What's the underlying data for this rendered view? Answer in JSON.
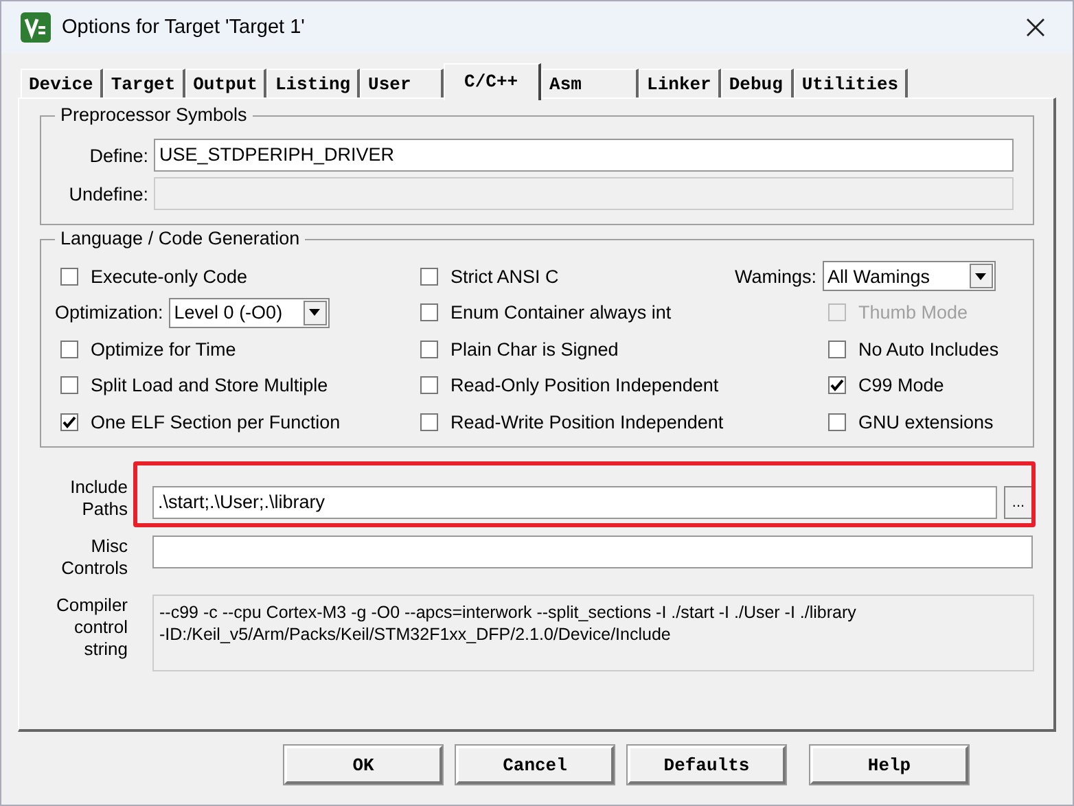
{
  "window": {
    "title": "Options for Target 'Target 1'"
  },
  "tabs": [
    {
      "label": "Device",
      "selected": false
    },
    {
      "label": "Target",
      "selected": false
    },
    {
      "label": "Output",
      "selected": false
    },
    {
      "label": "Listing",
      "selected": false
    },
    {
      "label": "User",
      "selected": false
    },
    {
      "label": "C/C++",
      "selected": true
    },
    {
      "label": "Asm",
      "selected": false
    },
    {
      "label": "Linker",
      "selected": false
    },
    {
      "label": "Debug",
      "selected": false
    },
    {
      "label": "Utilities",
      "selected": false
    }
  ],
  "preprocessor": {
    "title": "Preprocessor Symbols",
    "fields": [
      {
        "label": "Define:",
        "value": "USE_STDPERIPH_DRIVER",
        "disabled": false
      },
      {
        "label": "Undefine:",
        "disabled": true
      }
    ]
  },
  "language": {
    "title": "Language / Code Generation",
    "columns": [
      [
        {
          "kind": "checkbox",
          "label": "Execute-only Code",
          "checked": false,
          "disabled": false
        },
        {
          "kind": "select",
          "label": "Optimization:",
          "value": "Level 0 (-O0)"
        },
        {
          "kind": "checkbox",
          "label": "Optimize for Time",
          "checked": false,
          "disabled": false
        },
        {
          "kind": "checkbox",
          "label": "Split Load and Store Multiple",
          "checked": false,
          "disabled": false
        },
        {
          "kind": "checkbox",
          "label": "One ELF Section per Function",
          "checked": true,
          "disabled": false
        }
      ],
      [
        {
          "kind": "checkbox",
          "label": "Strict ANSI C",
          "checked": false,
          "disabled": false
        },
        {
          "kind": "checkbox",
          "label": "Enum Container always int",
          "checked": false,
          "disabled": false
        },
        {
          "kind": "checkbox",
          "label": "Plain Char is Signed",
          "checked": false,
          "disabled": false
        },
        {
          "kind": "checkbox",
          "label": "Read-Only Position Independent",
          "checked": false,
          "disabled": false
        },
        {
          "kind": "checkbox",
          "label": "Read-Write Position Independent",
          "checked": false,
          "disabled": false
        }
      ],
      [
        {
          "kind": "select",
          "label": "Wamings:",
          "value": "All Wamings"
        },
        {
          "kind": "checkbox",
          "label": "Thumb Mode",
          "checked": false,
          "disabled": true
        },
        {
          "kind": "checkbox",
          "label": "No Auto Includes",
          "checked": false,
          "disabled": false
        },
        {
          "kind": "checkbox",
          "label": "C99 Mode",
          "checked": true,
          "disabled": false
        },
        {
          "kind": "checkbox",
          "label": "GNU extensions",
          "checked": false,
          "disabled": false
        }
      ]
    ]
  },
  "include_paths": {
    "label_lines": [
      "Include",
      "Paths"
    ],
    "value": ".\\start;.\\User;.\\library",
    "browse": "...",
    "highlighted": true
  },
  "misc_controls": {
    "label_lines": [
      "Misc",
      "Controls"
    ]
  },
  "compiler_string": {
    "label_lines": [
      "Compiler",
      "control",
      "string"
    ],
    "lines": [
      "--c99 -c --cpu Cortex-M3 -g -O0 --apcs=interwork --split_sections -I ./start -I ./User -I ./library",
      "-ID:/Keil_v5/Arm/Packs/Keil/STM32F1xx_DFP/2.1.0/Device/Include"
    ]
  },
  "buttons": [
    "OK",
    "Cancel",
    "Defaults",
    "Help"
  ]
}
